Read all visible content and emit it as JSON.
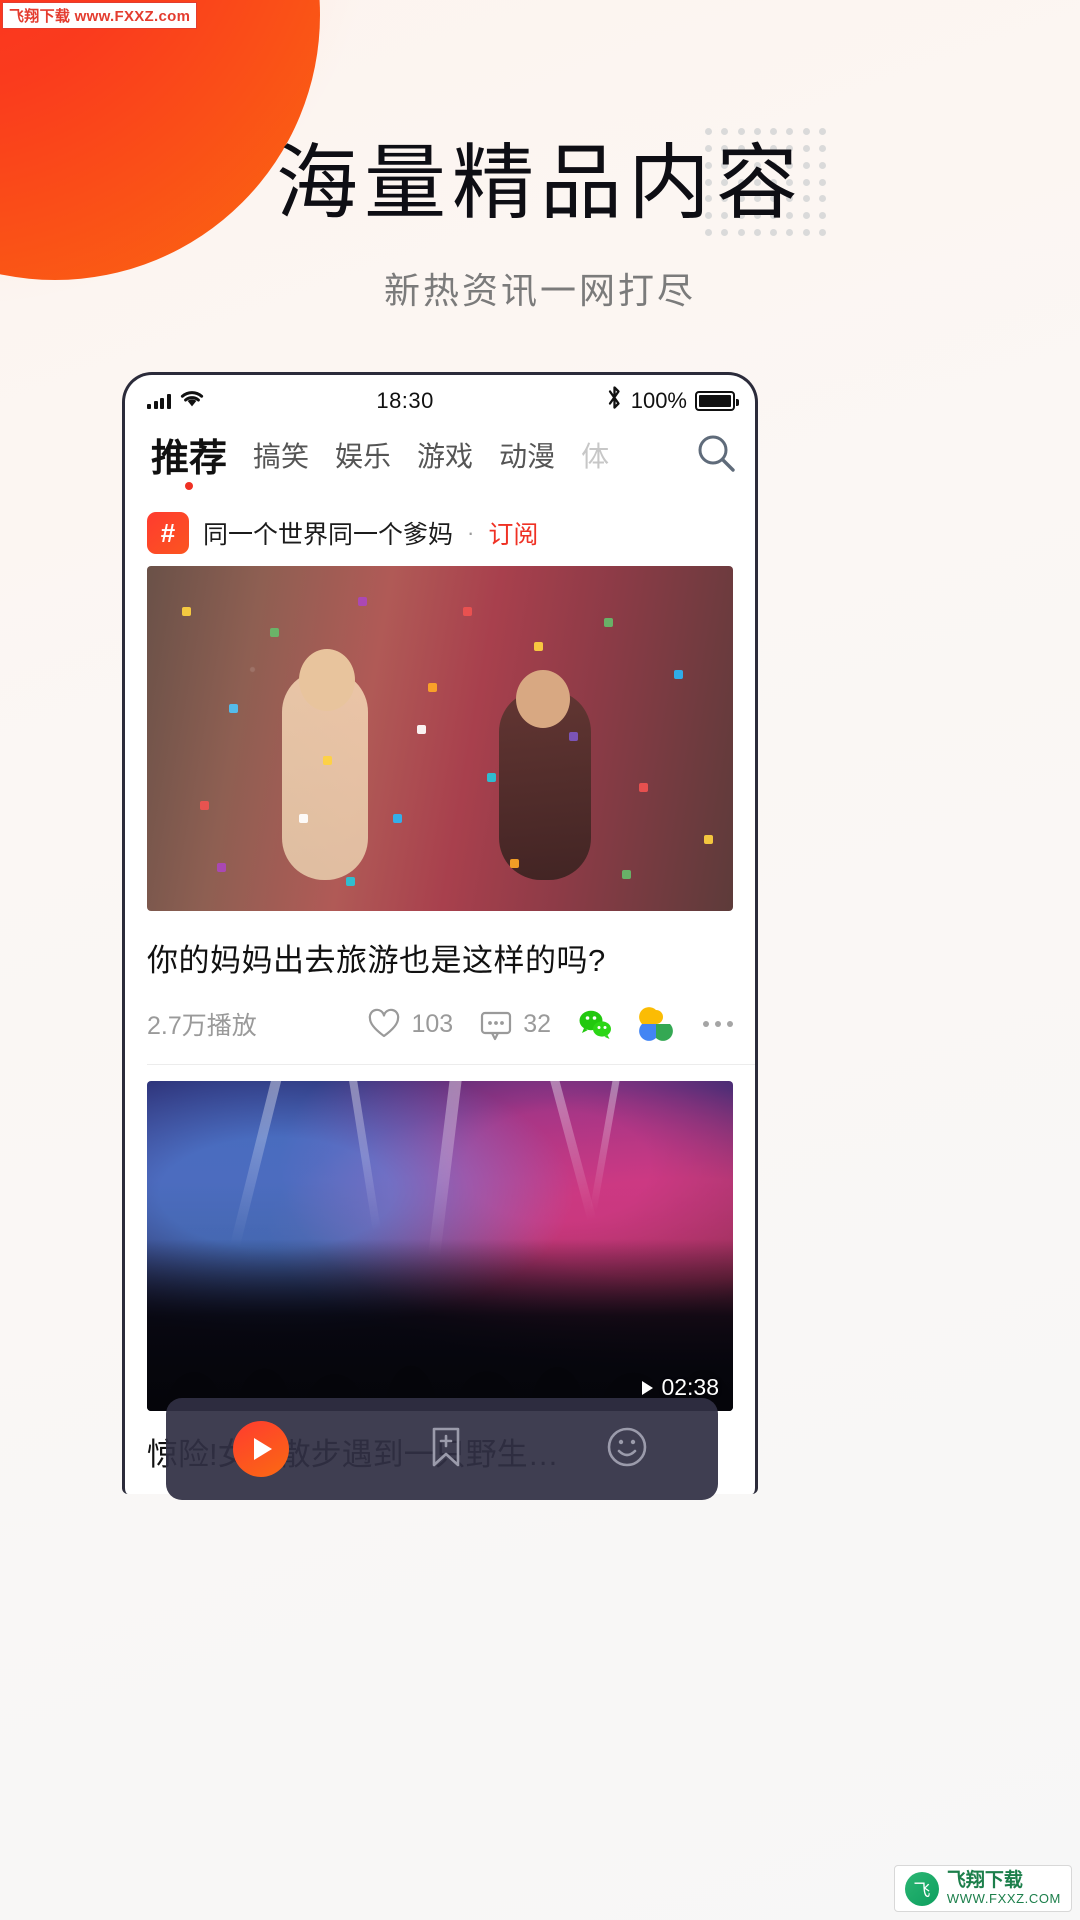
{
  "watermark_top": "飞翔下载 www.FXXZ.com",
  "watermark_bottom": {
    "name": "飞翔下载",
    "url": "WWW.FXXZ.COM"
  },
  "promo": {
    "headline": "海量精品内容",
    "subheadline": "新热资讯一网打尽",
    "accent_color": "#fa3b1d"
  },
  "phone": {
    "status_bar": {
      "time": "18:30",
      "battery_percent": "100%",
      "signal_icon": "signal-bars-icon",
      "wifi_icon": "wifi-icon",
      "bluetooth_icon": "bluetooth-icon",
      "battery_icon": "battery-full-icon"
    },
    "tabs": [
      {
        "label": "推荐",
        "active": true
      },
      {
        "label": "搞笑",
        "active": false
      },
      {
        "label": "娱乐",
        "active": false
      },
      {
        "label": "游戏",
        "active": false
      },
      {
        "label": "动漫",
        "active": false
      },
      {
        "label": "体",
        "active": false,
        "faded": true
      }
    ],
    "search_icon": "search-icon",
    "feed": [
      {
        "author_badge": "#",
        "author_name": "同一个世界同一个爹妈",
        "separator": "·",
        "subscribe_label": "订阅",
        "title": "你的妈妈出去旅游也是这样的吗?",
        "plays": "2.7万播放",
        "likes": "103",
        "comments": "32",
        "share_icons": [
          "wechat-icon",
          "google-photos-icon",
          "more-icon"
        ]
      },
      {
        "duration": "02:38",
        "title": "惊险!女子散步遇到一只野生…"
      }
    ],
    "floating_bar": {
      "play_label": "play-button",
      "bookmark_label": "bookmark-add-button",
      "emoji_label": "emoji-button"
    }
  }
}
